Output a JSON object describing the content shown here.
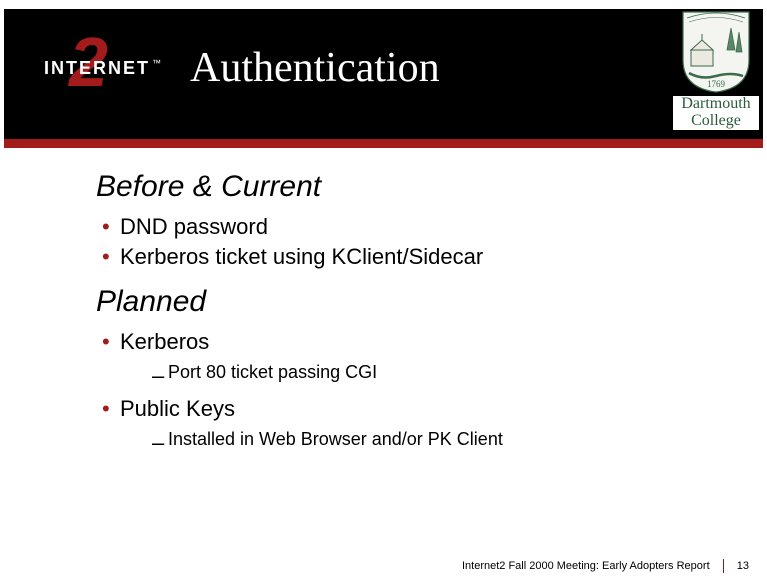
{
  "header": {
    "logo_word": "INTERNET",
    "logo_digit": "2",
    "logo_tm": "™",
    "title": "Authentication",
    "institution_line1": "Dartmouth",
    "institution_line2": "College",
    "shield_year": "1769"
  },
  "sections": [
    {
      "heading": "Before & Current",
      "bullets": [
        {
          "text": "DND password",
          "sub": []
        },
        {
          "text": "Kerberos ticket using KClient/Sidecar",
          "sub": []
        }
      ]
    },
    {
      "heading": "Planned",
      "bullets": [
        {
          "text": "Kerberos",
          "sub": [
            "Port 80 ticket passing CGI"
          ]
        },
        {
          "text": "Public Keys",
          "sub": [
            "Installed in Web Browser and/or PK Client"
          ]
        }
      ]
    }
  ],
  "footer": {
    "event": "Internet2 Fall 2000 Meeting: Early Adopters Report",
    "page": "13"
  }
}
